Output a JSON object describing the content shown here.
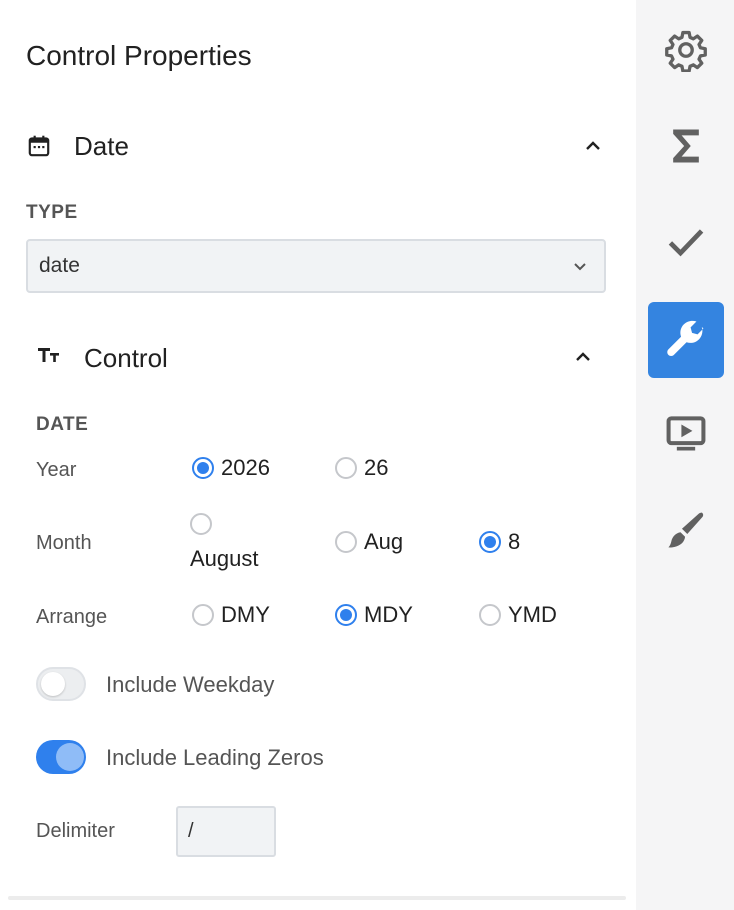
{
  "panel": {
    "title": "Control Properties"
  },
  "date_section": {
    "title": "Date",
    "icon": "calendar-icon",
    "type_caption": "TYPE",
    "type_value": "date"
  },
  "control_section": {
    "title": "Control",
    "icon": "text-format-icon",
    "date_caption": "DATE",
    "year": {
      "label": "Year",
      "options": [
        "2026",
        "26"
      ],
      "selected": "2026"
    },
    "month": {
      "label": "Month",
      "options": [
        "August",
        "Aug",
        "8"
      ],
      "selected": "8"
    },
    "arrange": {
      "label": "Arrange",
      "options": [
        "DMY",
        "MDY",
        "YMD"
      ],
      "selected": "MDY"
    },
    "include_weekday": {
      "label": "Include Weekday",
      "on": false
    },
    "include_leading_zeros": {
      "label": "Include Leading Zeros",
      "on": true
    },
    "delimiter": {
      "label": "Delimiter",
      "value": "/"
    }
  },
  "rail": {
    "items": [
      {
        "name": "settings",
        "icon": "gear-icon",
        "active": false
      },
      {
        "name": "sum",
        "icon": "sigma-icon",
        "active": false
      },
      {
        "name": "validation",
        "icon": "check-icon",
        "active": false
      },
      {
        "name": "properties",
        "icon": "wrench-icon",
        "active": true
      },
      {
        "name": "preview",
        "icon": "play-screen-icon",
        "active": false
      },
      {
        "name": "style",
        "icon": "brush-icon",
        "active": false
      }
    ]
  },
  "colors": {
    "accent": "#2f80ed",
    "rail_active": "#3484e0",
    "rail_bg": "#f5f5f6",
    "icon_gray": "#616161"
  }
}
